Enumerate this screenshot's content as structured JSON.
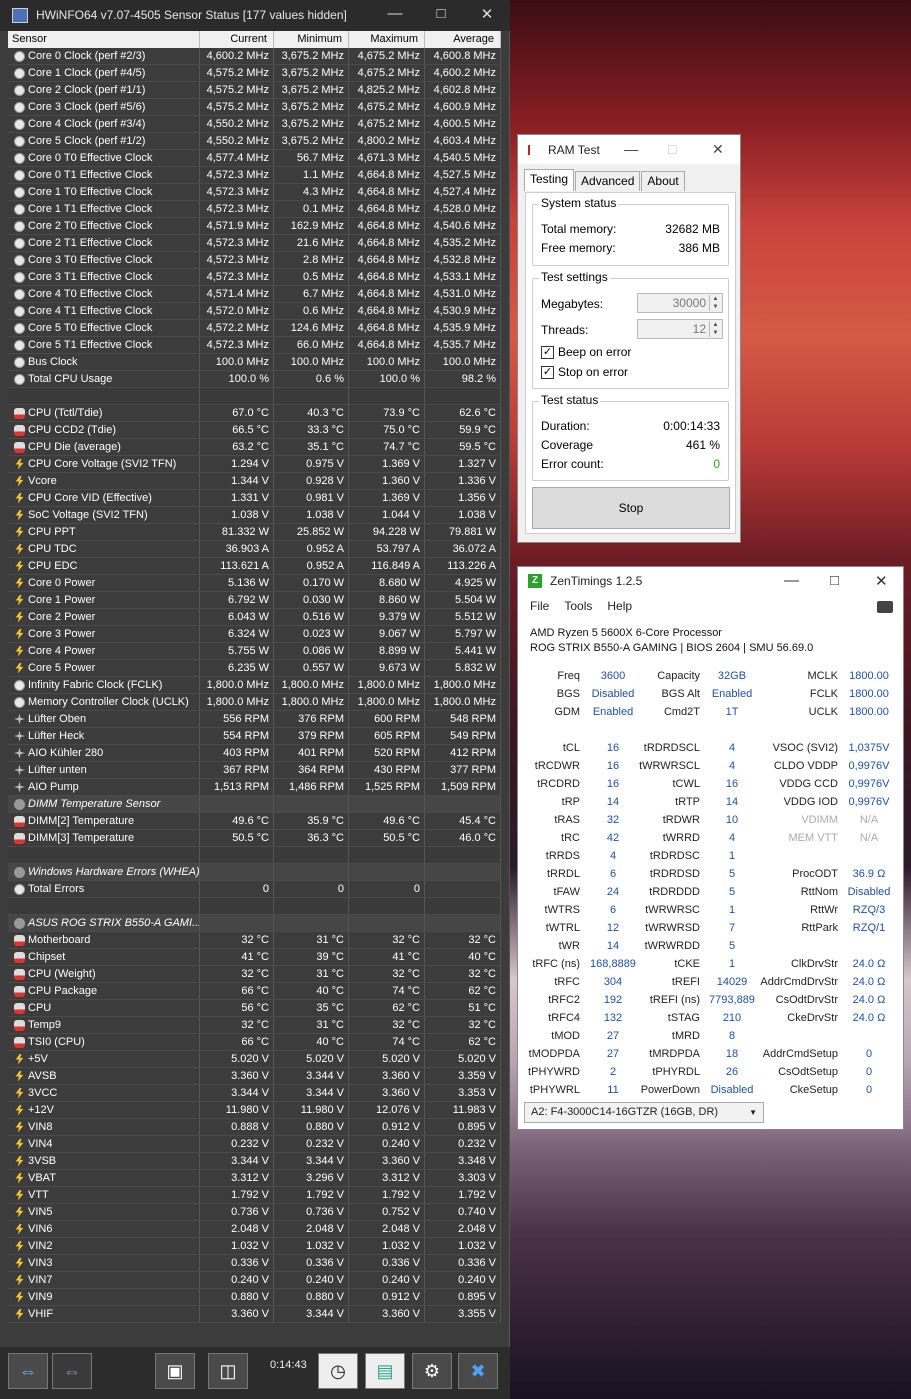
{
  "hwinfo": {
    "title": "HWiNFO64 v7.07-4505 Sensor Status [177 values hidden]",
    "headers": [
      "Sensor",
      "Current",
      "Minimum",
      "Maximum",
      "Average"
    ],
    "rows": [
      {
        "i": "clk",
        "n": "Core 0 Clock (perf #2/3)",
        "v": [
          "4,600.2 MHz",
          "3,675.2 MHz",
          "4,675.2 MHz",
          "4,600.8 MHz"
        ]
      },
      {
        "i": "clk",
        "n": "Core 1 Clock (perf #4/5)",
        "v": [
          "4,575.2 MHz",
          "3,675.2 MHz",
          "4,675.2 MHz",
          "4,600.2 MHz"
        ]
      },
      {
        "i": "clk",
        "n": "Core 2 Clock (perf #1/1)",
        "v": [
          "4,575.2 MHz",
          "3,675.2 MHz",
          "4,825.2 MHz",
          "4,602.8 MHz"
        ]
      },
      {
        "i": "clk",
        "n": "Core 3 Clock (perf #5/6)",
        "v": [
          "4,575.2 MHz",
          "3,675.2 MHz",
          "4,675.2 MHz",
          "4,600.9 MHz"
        ]
      },
      {
        "i": "clk",
        "n": "Core 4 Clock (perf #3/4)",
        "v": [
          "4,550.2 MHz",
          "3,675.2 MHz",
          "4,675.2 MHz",
          "4,600.5 MHz"
        ]
      },
      {
        "i": "clk",
        "n": "Core 5 Clock (perf #1/2)",
        "v": [
          "4,550.2 MHz",
          "3,675.2 MHz",
          "4,800.2 MHz",
          "4,603.4 MHz"
        ]
      },
      {
        "i": "clk",
        "n": "Core 0 T0 Effective Clock",
        "v": [
          "4,577.4 MHz",
          "56.7 MHz",
          "4,671.3 MHz",
          "4,540.5 MHz"
        ]
      },
      {
        "i": "clk",
        "n": "Core 0 T1 Effective Clock",
        "v": [
          "4,572.3 MHz",
          "1.1 MHz",
          "4,664.8 MHz",
          "4,527.5 MHz"
        ]
      },
      {
        "i": "clk",
        "n": "Core 1 T0 Effective Clock",
        "v": [
          "4,572.3 MHz",
          "4.3 MHz",
          "4,664.8 MHz",
          "4,527.4 MHz"
        ]
      },
      {
        "i": "clk",
        "n": "Core 1 T1 Effective Clock",
        "v": [
          "4,572.3 MHz",
          "0.1 MHz",
          "4,664.8 MHz",
          "4,528.0 MHz"
        ]
      },
      {
        "i": "clk",
        "n": "Core 2 T0 Effective Clock",
        "v": [
          "4,571.9 MHz",
          "162.9 MHz",
          "4,664.8 MHz",
          "4,540.6 MHz"
        ]
      },
      {
        "i": "clk",
        "n": "Core 2 T1 Effective Clock",
        "v": [
          "4,572.3 MHz",
          "21.6 MHz",
          "4,664.8 MHz",
          "4,535.2 MHz"
        ]
      },
      {
        "i": "clk",
        "n": "Core 3 T0 Effective Clock",
        "v": [
          "4,572.3 MHz",
          "2.8 MHz",
          "4,664.8 MHz",
          "4,532.8 MHz"
        ]
      },
      {
        "i": "clk",
        "n": "Core 3 T1 Effective Clock",
        "v": [
          "4,572.3 MHz",
          "0.5 MHz",
          "4,664.8 MHz",
          "4,533.1 MHz"
        ]
      },
      {
        "i": "clk",
        "n": "Core 4 T0 Effective Clock",
        "v": [
          "4,571.4 MHz",
          "6.7 MHz",
          "4,664.8 MHz",
          "4,531.0 MHz"
        ]
      },
      {
        "i": "clk",
        "n": "Core 4 T1 Effective Clock",
        "v": [
          "4,572.0 MHz",
          "0.6 MHz",
          "4,664.8 MHz",
          "4,530.9 MHz"
        ]
      },
      {
        "i": "clk",
        "n": "Core 5 T0 Effective Clock",
        "v": [
          "4,572.2 MHz",
          "124.6 MHz",
          "4,664.8 MHz",
          "4,535.9 MHz"
        ]
      },
      {
        "i": "clk",
        "n": "Core 5 T1 Effective Clock",
        "v": [
          "4,572.3 MHz",
          "66.0 MHz",
          "4,664.8 MHz",
          "4,535.7 MHz"
        ]
      },
      {
        "i": "clk",
        "n": "Bus Clock",
        "v": [
          "100.0 MHz",
          "100.0 MHz",
          "100.0 MHz",
          "100.0 MHz"
        ]
      },
      {
        "i": "clk",
        "n": "Total CPU Usage",
        "v": [
          "100.0 %",
          "0.6 %",
          "100.0 %",
          "98.2 %"
        ]
      },
      {
        "i": "blank",
        "n": "",
        "v": [
          "",
          "",
          "",
          ""
        ]
      },
      {
        "i": "tmp",
        "n": "CPU (Tctl/Tdie)",
        "v": [
          "67.0 °C",
          "40.3 °C",
          "73.9 °C",
          "62.6 °C"
        ]
      },
      {
        "i": "tmp",
        "n": "CPU CCD2 (Tdie)",
        "v": [
          "66.5 °C",
          "33.3 °C",
          "75.0 °C",
          "59.9 °C"
        ]
      },
      {
        "i": "tmp",
        "n": "CPU Die (average)",
        "v": [
          "63.2 °C",
          "35.1 °C",
          "74.7 °C",
          "59.5 °C"
        ]
      },
      {
        "i": "vlt",
        "n": "CPU Core Voltage (SVI2 TFN)",
        "v": [
          "1.294 V",
          "0.975 V",
          "1.369 V",
          "1.327 V"
        ]
      },
      {
        "i": "vlt",
        "n": "Vcore",
        "v": [
          "1.344 V",
          "0.928 V",
          "1.360 V",
          "1.336 V"
        ]
      },
      {
        "i": "vlt",
        "n": "CPU Core VID (Effective)",
        "v": [
          "1.331 V",
          "0.981 V",
          "1.369 V",
          "1.356 V"
        ]
      },
      {
        "i": "vlt",
        "n": "SoC Voltage (SVI2 TFN)",
        "v": [
          "1.038 V",
          "1.038 V",
          "1.044 V",
          "1.038 V"
        ]
      },
      {
        "i": "vlt",
        "n": "CPU PPT",
        "v": [
          "81.332 W",
          "25.852 W",
          "94.228 W",
          "79.881 W"
        ]
      },
      {
        "i": "vlt",
        "n": "CPU TDC",
        "v": [
          "36.903 A",
          "0.952 A",
          "53.797 A",
          "36.072 A"
        ]
      },
      {
        "i": "vlt",
        "n": "CPU EDC",
        "v": [
          "113.621 A",
          "0.952 A",
          "116.849 A",
          "113.226 A"
        ]
      },
      {
        "i": "vlt",
        "n": "Core 0 Power",
        "v": [
          "5.136 W",
          "0.170 W",
          "8.680 W",
          "4.925 W"
        ]
      },
      {
        "i": "vlt",
        "n": "Core 1 Power",
        "v": [
          "6.792 W",
          "0.030 W",
          "8.860 W",
          "5.504 W"
        ]
      },
      {
        "i": "vlt",
        "n": "Core 2 Power",
        "v": [
          "6.043 W",
          "0.516 W",
          "9.379 W",
          "5.512 W"
        ]
      },
      {
        "i": "vlt",
        "n": "Core 3 Power",
        "v": [
          "6.324 W",
          "0.023 W",
          "9.067 W",
          "5.797 W"
        ]
      },
      {
        "i": "vlt",
        "n": "Core 4 Power",
        "v": [
          "5.755 W",
          "0.086 W",
          "8.899 W",
          "5.441 W"
        ]
      },
      {
        "i": "vlt",
        "n": "Core 5 Power",
        "v": [
          "6.235 W",
          "0.557 W",
          "9.673 W",
          "5.832 W"
        ]
      },
      {
        "i": "clk",
        "n": "Infinity Fabric Clock (FCLK)",
        "v": [
          "1,800.0 MHz",
          "1,800.0 MHz",
          "1,800.0 MHz",
          "1,800.0 MHz"
        ]
      },
      {
        "i": "clk",
        "n": "Memory Controller Clock (UCLK)",
        "v": [
          "1,800.0 MHz",
          "1,800.0 MHz",
          "1,800.0 MHz",
          "1,800.0 MHz"
        ]
      },
      {
        "i": "fan",
        "n": "Lüfter Oben",
        "v": [
          "556 RPM",
          "376 RPM",
          "600 RPM",
          "548 RPM"
        ]
      },
      {
        "i": "fan",
        "n": "Lüfter Heck",
        "v": [
          "554 RPM",
          "379 RPM",
          "605 RPM",
          "549 RPM"
        ]
      },
      {
        "i": "fan",
        "n": "AIO Kühler 280",
        "v": [
          "403 RPM",
          "401 RPM",
          "520 RPM",
          "412 RPM"
        ]
      },
      {
        "i": "fan",
        "n": "Lüfter unten",
        "v": [
          "367 RPM",
          "364 RPM",
          "430 RPM",
          "377 RPM"
        ]
      },
      {
        "i": "fan",
        "n": "AIO Pump",
        "v": [
          "1,513 RPM",
          "1,486 RPM",
          "1,525 RPM",
          "1,509 RPM"
        ]
      },
      {
        "i": "grp",
        "n": "DIMM Temperature Sensor",
        "v": [
          "",
          "",
          "",
          ""
        ]
      },
      {
        "i": "tmp",
        "n": "DIMM[2] Temperature",
        "v": [
          "49.6 °C",
          "35.9 °C",
          "49.6 °C",
          "45.4 °C"
        ]
      },
      {
        "i": "tmp",
        "n": "DIMM[3] Temperature",
        "v": [
          "50.5 °C",
          "36.3 °C",
          "50.5 °C",
          "46.0 °C"
        ]
      },
      {
        "i": "blank",
        "n": "",
        "v": [
          "",
          "",
          "",
          ""
        ]
      },
      {
        "i": "grp",
        "n": "Windows Hardware Errors (WHEA)",
        "v": [
          "",
          "",
          "",
          ""
        ]
      },
      {
        "i": "clk",
        "n": "Total Errors",
        "v": [
          "0",
          "0",
          "0",
          ""
        ]
      },
      {
        "i": "blank",
        "n": "",
        "v": [
          "",
          "",
          "",
          ""
        ]
      },
      {
        "i": "grp",
        "n": "ASUS ROG STRIX B550-A GAMI...",
        "v": [
          "",
          "",
          "",
          ""
        ]
      },
      {
        "i": "tmp",
        "n": "Motherboard",
        "v": [
          "32 °C",
          "31 °C",
          "32 °C",
          "32 °C"
        ]
      },
      {
        "i": "tmp",
        "n": "Chipset",
        "v": [
          "41 °C",
          "39 °C",
          "41 °C",
          "40 °C"
        ]
      },
      {
        "i": "tmp",
        "n": "CPU (Weight)",
        "v": [
          "32 °C",
          "31 °C",
          "32 °C",
          "32 °C"
        ]
      },
      {
        "i": "tmp",
        "n": "CPU Package",
        "v": [
          "66 °C",
          "40 °C",
          "74 °C",
          "62 °C"
        ]
      },
      {
        "i": "tmp",
        "n": "CPU",
        "v": [
          "56 °C",
          "35 °C",
          "62 °C",
          "51 °C"
        ]
      },
      {
        "i": "tmp",
        "n": "Temp9",
        "v": [
          "32 °C",
          "31 °C",
          "32 °C",
          "32 °C"
        ]
      },
      {
        "i": "tmp",
        "n": "TSI0 (CPU)",
        "v": [
          "66 °C",
          "40 °C",
          "74 °C",
          "62 °C"
        ]
      },
      {
        "i": "vlt",
        "n": "+5V",
        "v": [
          "5.020 V",
          "5.020 V",
          "5.020 V",
          "5.020 V"
        ]
      },
      {
        "i": "vlt",
        "n": "AVSB",
        "v": [
          "3.360 V",
          "3.344 V",
          "3.360 V",
          "3.359 V"
        ]
      },
      {
        "i": "vlt",
        "n": "3VCC",
        "v": [
          "3.344 V",
          "3.344 V",
          "3.360 V",
          "3.353 V"
        ]
      },
      {
        "i": "vlt",
        "n": "+12V",
        "v": [
          "11.980 V",
          "11.980 V",
          "12.076 V",
          "11.983 V"
        ]
      },
      {
        "i": "vlt",
        "n": "VIN8",
        "v": [
          "0.888 V",
          "0.880 V",
          "0.912 V",
          "0.895 V"
        ]
      },
      {
        "i": "vlt",
        "n": "VIN4",
        "v": [
          "0.232 V",
          "0.232 V",
          "0.240 V",
          "0.232 V"
        ]
      },
      {
        "i": "vlt",
        "n": "3VSB",
        "v": [
          "3.344 V",
          "3.344 V",
          "3.360 V",
          "3.348 V"
        ]
      },
      {
        "i": "vlt",
        "n": "VBAT",
        "v": [
          "3.312 V",
          "3.296 V",
          "3.312 V",
          "3.303 V"
        ]
      },
      {
        "i": "vlt",
        "n": "VTT",
        "v": [
          "1.792 V",
          "1.792 V",
          "1.792 V",
          "1.792 V"
        ]
      },
      {
        "i": "vlt",
        "n": "VIN5",
        "v": [
          "0.736 V",
          "0.736 V",
          "0.752 V",
          "0.740 V"
        ]
      },
      {
        "i": "vlt",
        "n": "VIN6",
        "v": [
          "2.048 V",
          "2.048 V",
          "2.048 V",
          "2.048 V"
        ]
      },
      {
        "i": "vlt",
        "n": "VIN2",
        "v": [
          "1.032 V",
          "1.032 V",
          "1.032 V",
          "1.032 V"
        ]
      },
      {
        "i": "vlt",
        "n": "VIN3",
        "v": [
          "0.336 V",
          "0.336 V",
          "0.336 V",
          "0.336 V"
        ]
      },
      {
        "i": "vlt",
        "n": "VIN7",
        "v": [
          "0.240 V",
          "0.240 V",
          "0.240 V",
          "0.240 V"
        ]
      },
      {
        "i": "vlt",
        "n": "VIN9",
        "v": [
          "0.880 V",
          "0.880 V",
          "0.912 V",
          "0.895 V"
        ]
      },
      {
        "i": "vlt",
        "n": "VHIF",
        "v": [
          "3.360 V",
          "3.344 V",
          "3.360 V",
          "3.355 V"
        ]
      }
    ],
    "elapsed": "0:14:43"
  },
  "ramtest": {
    "title": "RAM Test",
    "tabs": [
      "Testing",
      "Advanced",
      "About"
    ],
    "system_status": "System status",
    "total_memory_label": "Total memory:",
    "total_memory": "32682 MB",
    "free_memory_label": "Free memory:",
    "free_memory": "386 MB",
    "test_settings": "Test settings",
    "megabytes_label": "Megabytes:",
    "megabytes": "30000",
    "threads_label": "Threads:",
    "threads": "12",
    "beep_label": "Beep on error",
    "stop_on_error_label": "Stop on error",
    "test_status": "Test status",
    "duration_label": "Duration:",
    "duration": "0:00:14:33",
    "coverage_label": "Coverage",
    "coverage": "461 %",
    "errors_label": "Error count:",
    "errors": "0",
    "stop_button": "Stop"
  },
  "zen": {
    "title": "ZenTimings 1.2.5",
    "menu": [
      "File",
      "Tools",
      "Help"
    ],
    "cpu": "AMD Ryzen 5 5600X 6-Core Processor",
    "board": "ROG STRIX B550-A GAMING | BIOS 2604 | SMU 56.69.0",
    "col1": [
      [
        "Freq",
        "3600"
      ],
      [
        "BGS",
        "Disabled"
      ],
      [
        "GDM",
        "Enabled"
      ],
      [
        "",
        ""
      ],
      [
        "tCL",
        "16"
      ],
      [
        "tRCDWR",
        "16"
      ],
      [
        "tRCDRD",
        "16"
      ],
      [
        "tRP",
        "14"
      ],
      [
        "tRAS",
        "32"
      ],
      [
        "tRC",
        "42"
      ],
      [
        "tRRDS",
        "4"
      ],
      [
        "tRRDL",
        "6"
      ],
      [
        "tFAW",
        "24"
      ],
      [
        "tWTRS",
        "6"
      ],
      [
        "tWTRL",
        "12"
      ],
      [
        "tWR",
        "14"
      ],
      [
        "tRFC (ns)",
        "168,8889"
      ],
      [
        "tRFC",
        "304"
      ],
      [
        "tRFC2",
        "192"
      ],
      [
        "tRFC4",
        "132"
      ],
      [
        "tMOD",
        "27"
      ],
      [
        "tMODPDA",
        "27"
      ],
      [
        "tPHYWRD",
        "2"
      ],
      [
        "tPHYWRL",
        "11"
      ]
    ],
    "col2": [
      [
        "Capacity",
        "32GB"
      ],
      [
        "BGS Alt",
        "Enabled"
      ],
      [
        "Cmd2T",
        "1T"
      ],
      [
        "",
        ""
      ],
      [
        "tRDRDSCL",
        "4"
      ],
      [
        "tWRWRSCL",
        "4"
      ],
      [
        "tCWL",
        "16"
      ],
      [
        "tRTP",
        "14"
      ],
      [
        "tRDWR",
        "10"
      ],
      [
        "tWRRD",
        "4"
      ],
      [
        "tRDRDSC",
        "1"
      ],
      [
        "tRDRDSD",
        "5"
      ],
      [
        "tRDRDDD",
        "5"
      ],
      [
        "tWRWRSC",
        "1"
      ],
      [
        "tWRWRSD",
        "7"
      ],
      [
        "tWRWRDD",
        "5"
      ],
      [
        "tCKE",
        "1"
      ],
      [
        "tREFI",
        "14029"
      ],
      [
        "tREFI (ns)",
        "7793,889"
      ],
      [
        "tSTAG",
        "210"
      ],
      [
        "tMRD",
        "8"
      ],
      [
        "tMRDPDA",
        "18"
      ],
      [
        "tPHYRDL",
        "26"
      ],
      [
        "PowerDown",
        "Disabled"
      ]
    ],
    "col3": [
      [
        "MCLK",
        "1800.00"
      ],
      [
        "FCLK",
        "1800.00"
      ],
      [
        "UCLK",
        "1800.00"
      ],
      [
        "",
        ""
      ],
      [
        "VSOC (SVI2)",
        "1,0375V"
      ],
      [
        "CLDO VDDP",
        "0,9976V"
      ],
      [
        "VDDG CCD",
        "0,9976V"
      ],
      [
        "VDDG IOD",
        "0,9976V"
      ],
      [
        "VDIMM",
        "N/A"
      ],
      [
        "MEM VTT",
        "N/A"
      ],
      [
        "",
        ""
      ],
      [
        "ProcODT",
        "36.9 Ω"
      ],
      [
        "RttNom",
        "Disabled"
      ],
      [
        "RttWr",
        "RZQ/3"
      ],
      [
        "RttPark",
        "RZQ/1"
      ],
      [
        "",
        ""
      ],
      [
        "ClkDrvStr",
        "24.0 Ω"
      ],
      [
        "AddrCmdDrvStr",
        "24.0 Ω"
      ],
      [
        "CsOdtDrvStr",
        "24.0 Ω"
      ],
      [
        "CkeDrvStr",
        "24.0 Ω"
      ],
      [
        "",
        ""
      ],
      [
        "AddrCmdSetup",
        "0"
      ],
      [
        "CsOdtSetup",
        "0"
      ],
      [
        "CkeSetup",
        "0"
      ]
    ],
    "module": "A2: F4-3000C14-16GTZR (16GB, DR)"
  }
}
